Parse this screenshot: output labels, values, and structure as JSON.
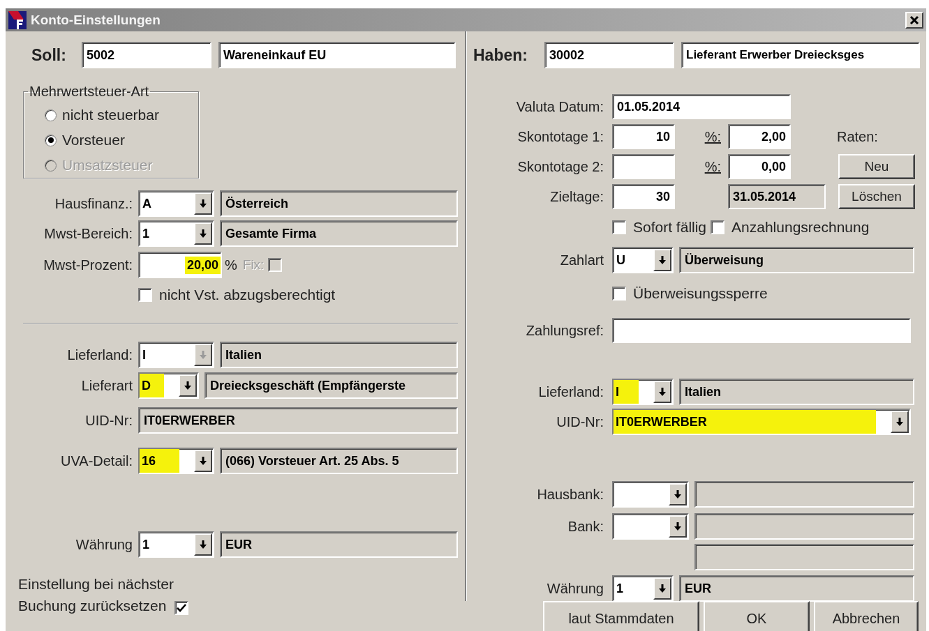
{
  "window": {
    "title": "Konto-Einstellungen"
  },
  "soll": {
    "label": "Soll:",
    "number": "5002",
    "name": "Wareneinkauf EU"
  },
  "haben": {
    "label": "Haben:",
    "number": "30002",
    "name": "Lieferant Erwerber Dreiecksges"
  },
  "vat_type": {
    "legend": "Mehrwertsteuer-Art",
    "options": [
      {
        "label": "nicht steuerbar",
        "selected": false,
        "disabled": false
      },
      {
        "label": "Vorsteuer",
        "selected": true,
        "disabled": false
      },
      {
        "label": "Umsatzsteuer",
        "selected": false,
        "disabled": true
      }
    ]
  },
  "tax_rows": [
    {
      "label": "Hausfinanz.:",
      "value": "A",
      "description": "Österreich",
      "highlighted": false,
      "disabled": false
    },
    {
      "label": "Mwst-Bereich:",
      "value": "1",
      "description": "Gesamte Firma",
      "highlighted": false,
      "disabled": false
    }
  ],
  "vat_percent": {
    "label": "Mwst-Prozent:",
    "value": "20,00",
    "unit": "%",
    "highlighted": true,
    "fix_label": "Fix:",
    "fix_checked": false,
    "fix_disabled": true
  },
  "not_deductible": {
    "label": "nicht Vst. abzugsberechtigt",
    "checked": false
  },
  "left_delivery": [
    {
      "kind": "combo",
      "label": "Lieferland:",
      "value": "I",
      "description": "Italien",
      "highlighted": false,
      "disabled": true
    },
    {
      "kind": "combo",
      "label": "Lieferart",
      "value": "D",
      "description": "Dreiecksgeschäft (Empfängerste",
      "highlighted": true,
      "disabled": false
    },
    {
      "kind": "text",
      "label": "UID-Nr:",
      "value": "IT0ERWERBER"
    },
    {
      "kind": "combo",
      "label": "UVA-Detail:",
      "value": "16",
      "description": "(066) Vorsteuer Art. 25 Abs. 5",
      "highlighted": true,
      "disabled": false
    }
  ],
  "left_currency": {
    "label": "Währung",
    "value": "1",
    "description": "EUR",
    "highlighted": false,
    "disabled": false
  },
  "reset_option": {
    "label": "Einstellung bei nächster Buchung zurücksetzen",
    "checked": true
  },
  "payment": {
    "valuta_label": "Valuta Datum:",
    "valuta": "01.05.2014",
    "discounts": [
      {
        "label": "Skontotage 1:",
        "days": "10",
        "percent_label": "%:",
        "percent": "2,00"
      },
      {
        "label": "Skontotage 2:",
        "percent_label": "%:",
        "percent": "0,00"
      }
    ],
    "target_label": "Zieltage:",
    "target_days": "30",
    "due_date": "31.05.2014",
    "installments_label": "Raten:",
    "installment_buttons": [
      "Neu",
      "Löschen"
    ]
  },
  "payment_flags": [
    {
      "label": "Sofort fällig",
      "checked": false
    },
    {
      "label": "Anzahlungsrechnung",
      "checked": false
    }
  ],
  "payment_method": {
    "label": "Zahlart",
    "value": "U",
    "description": "Überweisung",
    "highlighted": false,
    "disabled": false
  },
  "transfer_block": {
    "label": "Überweisungssperre",
    "checked": false
  },
  "payment_ref": {
    "label": "Zahlungsref:"
  },
  "right_delivery": [
    {
      "kind": "combo",
      "label": "Lieferland:",
      "value": "I",
      "description": "Italien",
      "highlighted": true,
      "disabled": false
    },
    {
      "kind": "wide_combo",
      "label": "UID-Nr:",
      "value": "IT0ERWERBER",
      "highlighted": true,
      "disabled": false
    }
  ],
  "banks": [
    {
      "label": "Hausbank:",
      "highlighted": false,
      "disabled": false
    },
    {
      "label": "Bank:",
      "highlighted": false,
      "disabled": false
    }
  ],
  "right_currency": {
    "label": "Währung",
    "value": "1",
    "description": "EUR",
    "highlighted": false,
    "disabled": false
  },
  "buttons": [
    "laut Stammdaten",
    "OK",
    "Abbrechen"
  ]
}
